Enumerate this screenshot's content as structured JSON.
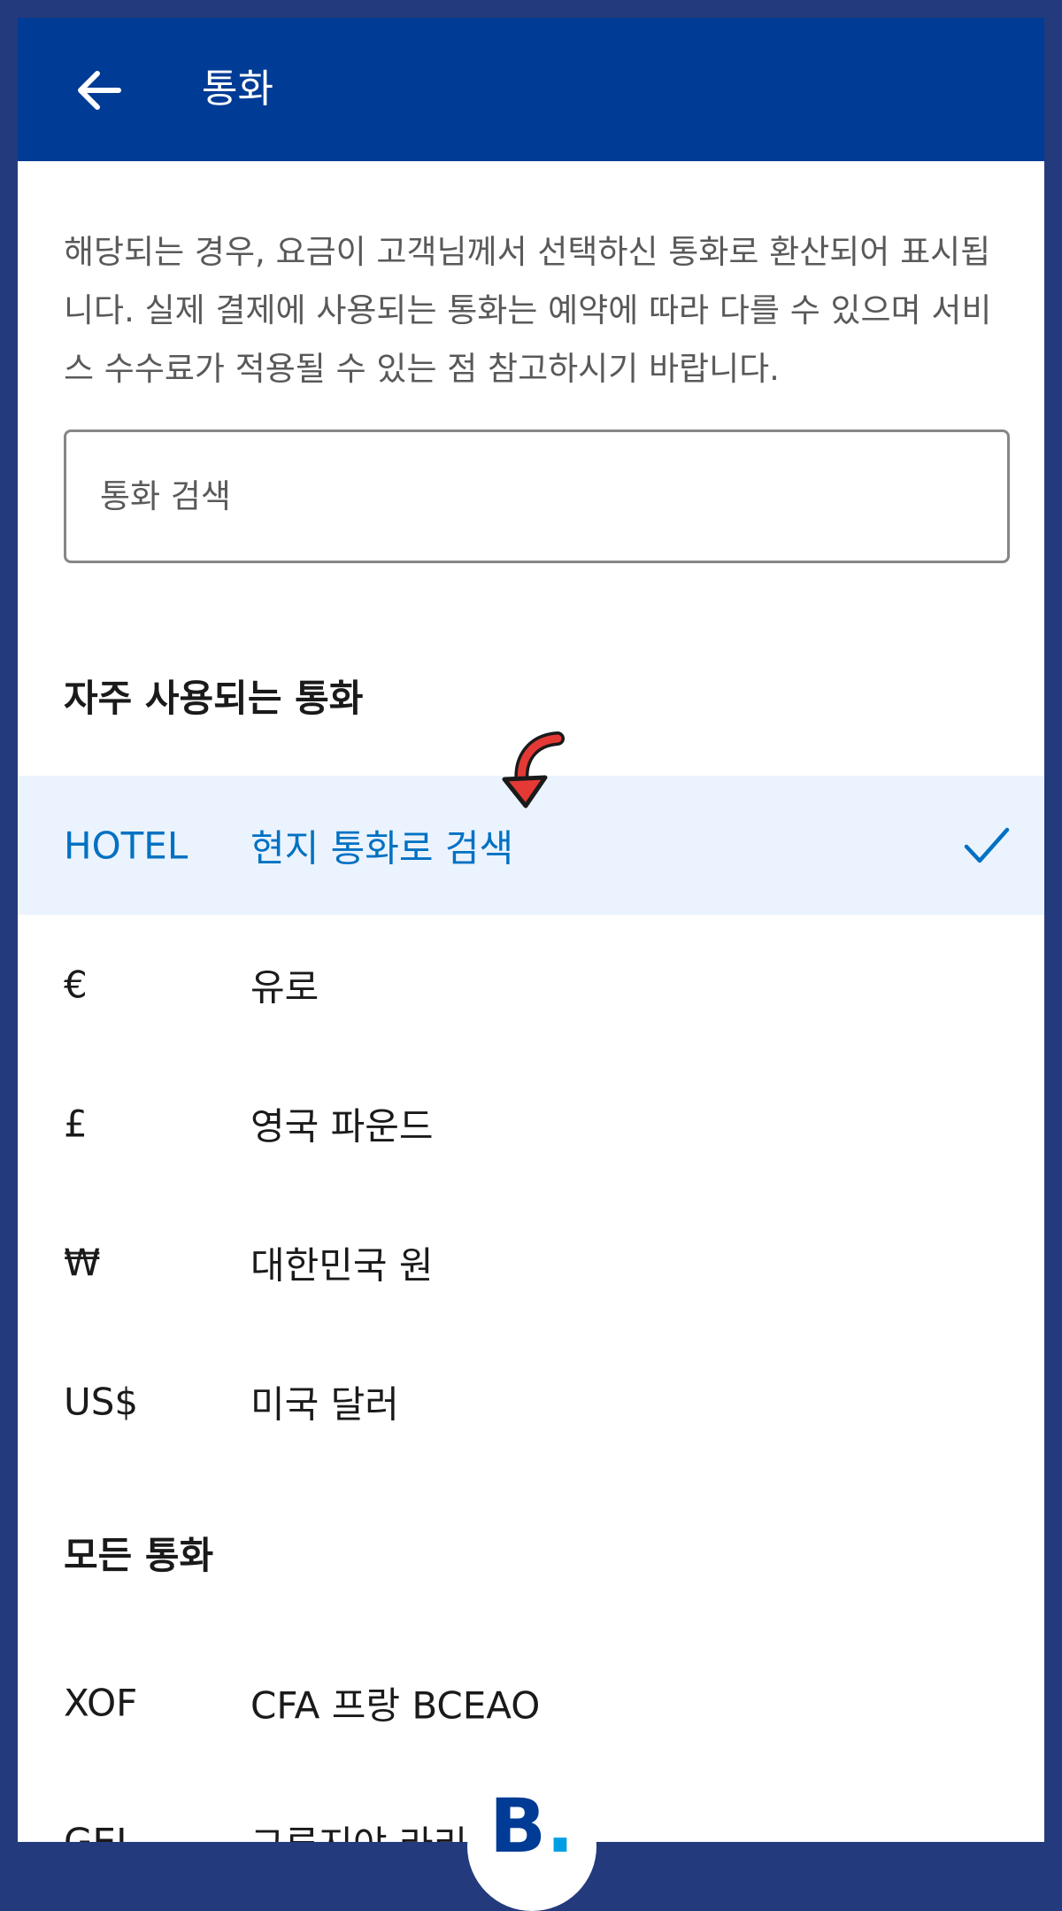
{
  "header": {
    "title": "통화"
  },
  "notice": "해당되는 경우, 요금이 고객님께서 선택하신 통화로 환산되어 표시됩니다. 실제 결제에 사용되는 통화는 예약에 따라 다를 수 있으며 서비스 수수료가 적용될 수 있는 점 참고하시기 바랍니다.",
  "search": {
    "placeholder": "통화 검색"
  },
  "frequent": {
    "title": "자주 사용되는 통화",
    "items": [
      {
        "code": "HOTEL",
        "name": "현지 통화로 검색",
        "selected": true
      },
      {
        "code": "€",
        "name": "유로"
      },
      {
        "code": "£",
        "name": "영국 파운드"
      },
      {
        "code": "₩",
        "name": "대한민국 원"
      },
      {
        "code": "US$",
        "name": "미국 달러"
      }
    ]
  },
  "all": {
    "title": "모든 통화",
    "items": [
      {
        "code": "XOF",
        "name": "CFA 프랑 BCEAO"
      },
      {
        "code": "GEL",
        "name": "그루지야 라리"
      }
    ]
  },
  "logo": {
    "letter": "B",
    "dot": "."
  },
  "colors": {
    "appbar": "#003b95",
    "accent": "#0071c2",
    "selected_bg": "#ebf3ff",
    "outer_bg": "#233a7c",
    "annotation": "#e53935"
  },
  "icons": {
    "back": "arrow-left-icon",
    "check": "checkmark-icon",
    "annotation": "curved-arrow-icon"
  }
}
